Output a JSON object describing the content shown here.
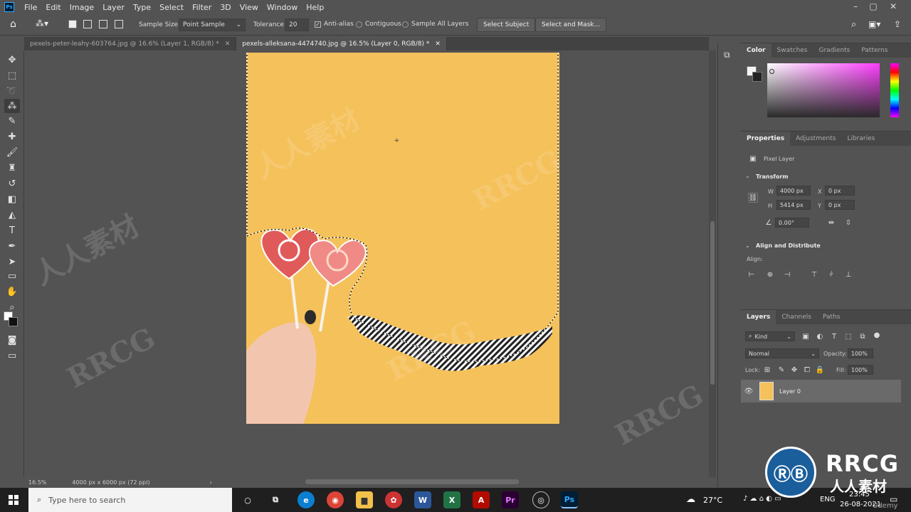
{
  "menubar": {
    "logo": "Ps",
    "items": [
      "File",
      "Edit",
      "Image",
      "Layer",
      "Type",
      "Select",
      "Filter",
      "3D",
      "View",
      "Window",
      "Help"
    ]
  },
  "options": {
    "sample_size_label": "Sample Size:",
    "sample_size_value": "Point Sample",
    "tolerance_label": "Tolerance:",
    "tolerance_value": "20",
    "anti_alias_label": "Anti-alias",
    "contiguous_label": "Contiguous",
    "sample_all_label": "Sample All Layers",
    "select_subject_label": "Select Subject",
    "select_mask_label": "Select and Mask..."
  },
  "tabs": [
    {
      "label": "pexels-peter-leahy-603764.jpg @ 16.6% (Layer 1, RGB/8) *",
      "active": false
    },
    {
      "label": "pexels-alleksana-4474740.jpg @ 16.5% (Layer 0, RGB/8) *",
      "active": true
    }
  ],
  "status": {
    "zoom": "16.5%",
    "doc_info": "4000 px x 6000 px (72 ppi)"
  },
  "color_panel": {
    "tabs": [
      "Color",
      "Swatches",
      "Gradients",
      "Patterns"
    ]
  },
  "properties_panel": {
    "tabs": [
      "Properties",
      "Adjustments",
      "Libraries"
    ],
    "layer_type": "Pixel Layer",
    "transform_title": "Transform",
    "w_label": "W",
    "w_value": "4000 px",
    "h_label": "H",
    "h_value": "5414 px",
    "x_label": "X",
    "x_value": "0 px",
    "y_label": "Y",
    "y_value": "0 px",
    "angle_value": "0.00°",
    "align_title": "Align and Distribute",
    "align_label": "Align:"
  },
  "layers_panel": {
    "tabs": [
      "Layers",
      "Channels",
      "Paths"
    ],
    "kind_label": "Kind",
    "blend_mode": "Normal",
    "opacity_label": "Opacity:",
    "opacity_value": "100%",
    "lock_label": "Lock:",
    "fill_label": "Fill:",
    "fill_value": "100%",
    "layer_name": "Layer 0"
  },
  "taskbar": {
    "search_placeholder": "Type here to search",
    "temperature": "27°C",
    "language": "ENG",
    "time": "23:45",
    "date": "26-08-2021"
  },
  "watermark": {
    "latin": "RRCG",
    "cjk": "人人素材",
    "udemy": "Udemy"
  },
  "colors": {
    "canvas_yellow": "#f5c15a",
    "ps_blue": "#31a8ff",
    "panel_bg": "#535353"
  }
}
